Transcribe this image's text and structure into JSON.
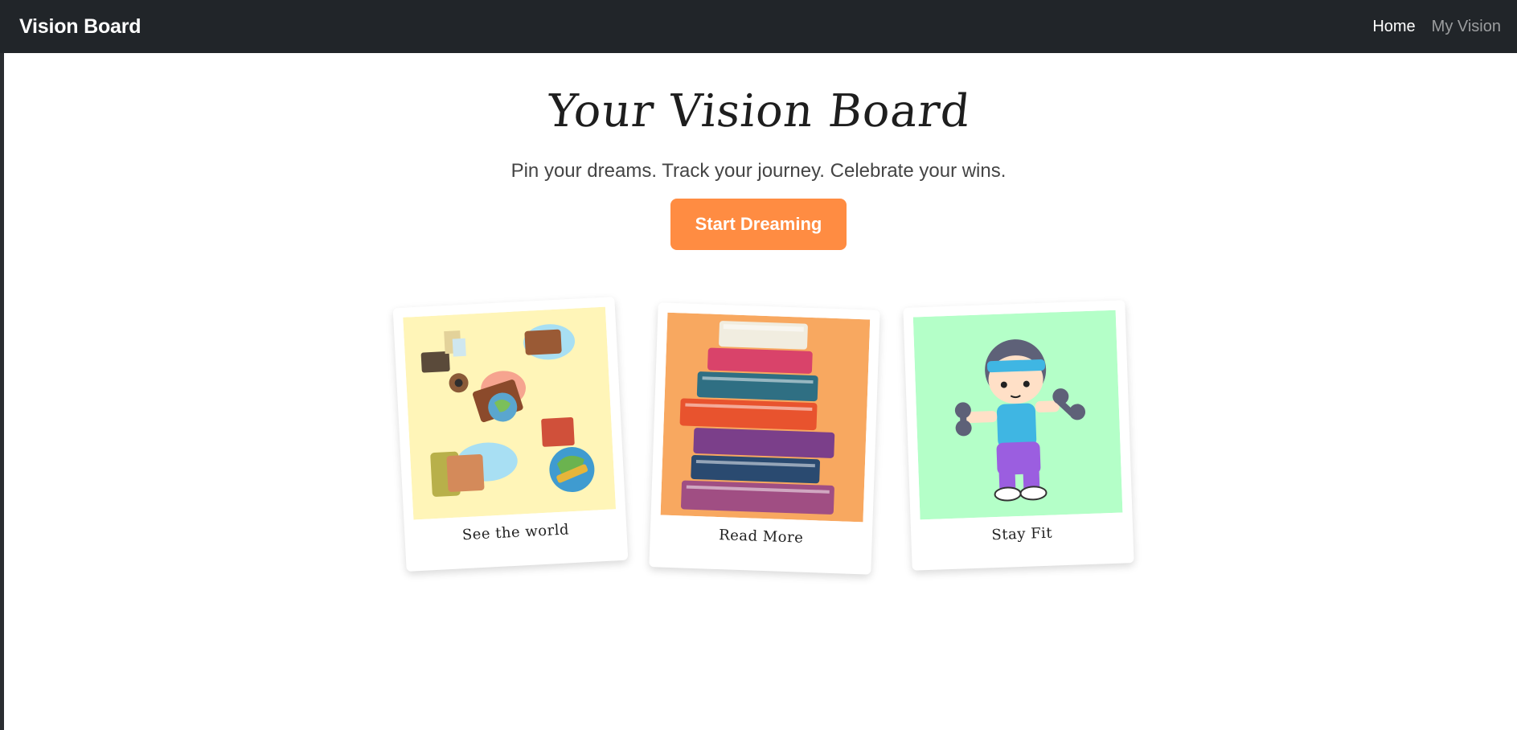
{
  "navbar": {
    "brand": "Vision Board",
    "links": [
      {
        "label": "Home",
        "active": true
      },
      {
        "label": "My Vision",
        "active": false
      }
    ]
  },
  "hero": {
    "title": "Your Vision Board",
    "subtitle": "Pin your dreams. Track your journey. Celebrate your wins.",
    "cta_label": "Start Dreaming"
  },
  "cards": [
    {
      "caption": "See the world",
      "image": "travel-illustration",
      "bg": "#fff5b8"
    },
    {
      "caption": "Read More",
      "image": "books-stack-illustration",
      "bg": "#f8a860"
    },
    {
      "caption": "Stay Fit",
      "image": "fitness-boy-illustration",
      "bg": "#b4ffc8"
    }
  ],
  "colors": {
    "navbar_bg": "#212529",
    "cta_bg": "#ff8c42"
  }
}
